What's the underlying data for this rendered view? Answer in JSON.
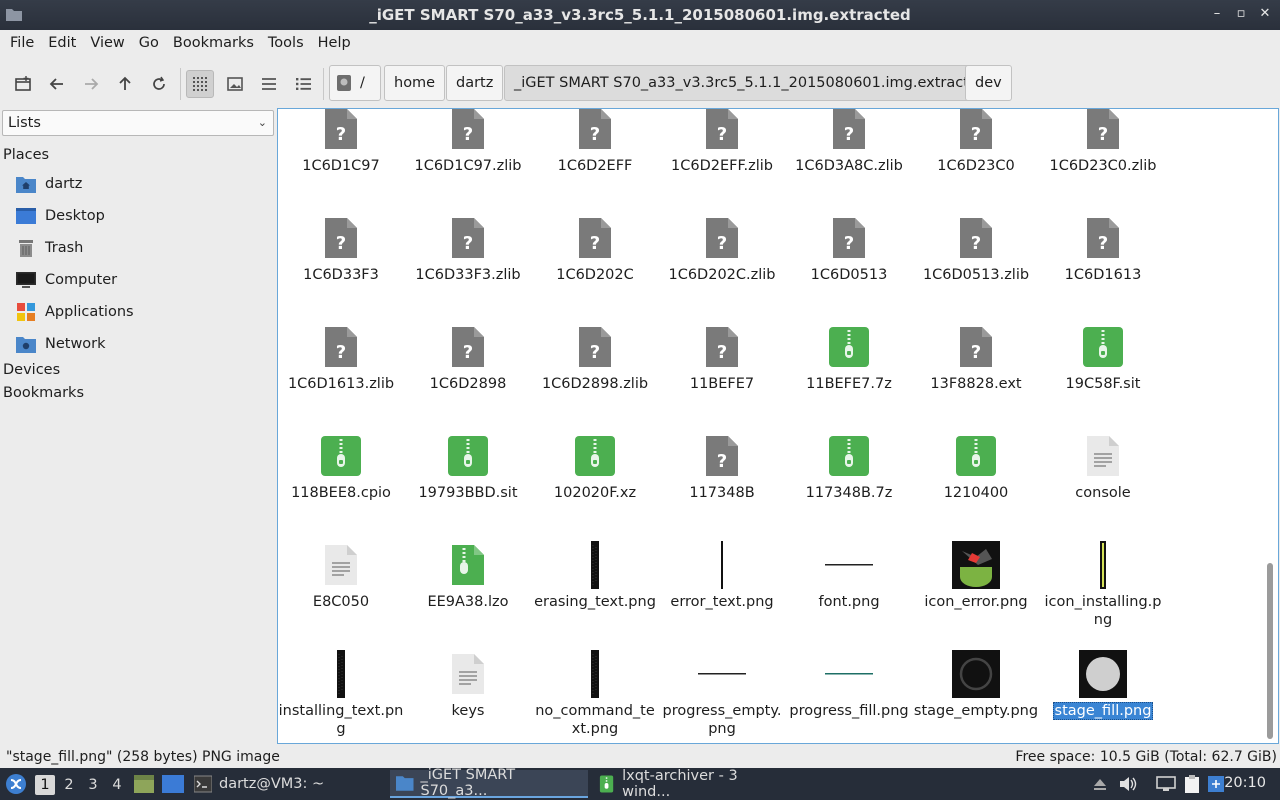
{
  "window": {
    "title": "_iGET SMART S70_a33_v3.3rc5_5.1.1_2015080601.img.extracted",
    "controls": [
      "–",
      "▫",
      "✕"
    ]
  },
  "menu": [
    "File",
    "Edit",
    "View",
    "Go",
    "Bookmarks",
    "Tools",
    "Help"
  ],
  "path": {
    "root": "/",
    "crumbs": [
      "home",
      "dartz",
      "_iGET SMART S70_a33_v3.3rc5_5.1.1_2015080601.img.extracted",
      "dev"
    ]
  },
  "sidebar": {
    "mode": "Lists",
    "places_header": "Places",
    "places": [
      {
        "label": "dartz",
        "icon": "home-folder-icon"
      },
      {
        "label": "Desktop",
        "icon": "desktop-icon"
      },
      {
        "label": "Trash",
        "icon": "trash-icon"
      },
      {
        "label": "Computer",
        "icon": "computer-icon"
      },
      {
        "label": "Applications",
        "icon": "applications-icon"
      },
      {
        "label": "Network",
        "icon": "network-icon"
      }
    ],
    "devices_header": "Devices",
    "bookmarks_header": "Bookmarks"
  },
  "files": [
    {
      "name": "1C6D1C97",
      "type": "unknown"
    },
    {
      "name": "1C6D1C97.zlib",
      "type": "unknown"
    },
    {
      "name": "1C6D2EFF",
      "type": "unknown"
    },
    {
      "name": "1C6D2EFF.zlib",
      "type": "unknown"
    },
    {
      "name": "1C6D3A8C.zlib",
      "type": "unknown"
    },
    {
      "name": "1C6D23C0",
      "type": "unknown"
    },
    {
      "name": "1C6D23C0.zlib",
      "type": "unknown"
    },
    {
      "name": "1C6D33F3",
      "type": "unknown"
    },
    {
      "name": "1C6D33F3.zlib",
      "type": "unknown"
    },
    {
      "name": "1C6D202C",
      "type": "unknown"
    },
    {
      "name": "1C6D202C.zlib",
      "type": "unknown"
    },
    {
      "name": "1C6D0513",
      "type": "unknown"
    },
    {
      "name": "1C6D0513.zlib",
      "type": "unknown"
    },
    {
      "name": "1C6D1613",
      "type": "unknown"
    },
    {
      "name": "1C6D1613.zlib",
      "type": "unknown"
    },
    {
      "name": "1C6D2898",
      "type": "unknown"
    },
    {
      "name": "1C6D2898.zlib",
      "type": "unknown"
    },
    {
      "name": "11BEFE7",
      "type": "unknown"
    },
    {
      "name": "11BEFE7.7z",
      "type": "archive"
    },
    {
      "name": "13F8828.ext",
      "type": "unknown"
    },
    {
      "name": "19C58F.sit",
      "type": "archive"
    },
    {
      "name": "118BEE8.cpio",
      "type": "archive"
    },
    {
      "name": "19793BBD.sit",
      "type": "archive"
    },
    {
      "name": "102020F.xz",
      "type": "archive"
    },
    {
      "name": "117348B",
      "type": "unknown"
    },
    {
      "name": "117348B.7z",
      "type": "archive"
    },
    {
      "name": "1210400",
      "type": "archive"
    },
    {
      "name": "console",
      "type": "text"
    },
    {
      "name": "E8C050",
      "type": "text"
    },
    {
      "name": "EE9A38.lzo",
      "type": "archive-page"
    },
    {
      "name": "erasing_text.png",
      "type": "img-vbar"
    },
    {
      "name": "error_text.png",
      "type": "img-vline"
    },
    {
      "name": "font.png",
      "type": "img-hline"
    },
    {
      "name": "icon_error.png",
      "type": "img-android"
    },
    {
      "name": "icon_installing.png",
      "type": "img-yellowbar"
    },
    {
      "name": "installing_text.png",
      "type": "img-vbar"
    },
    {
      "name": "keys",
      "type": "text"
    },
    {
      "name": "no_command_text.png",
      "type": "img-vbar"
    },
    {
      "name": "progress_empty.png",
      "type": "img-hline"
    },
    {
      "name": "progress_fill.png",
      "type": "img-hline-teal"
    },
    {
      "name": "stage_empty.png",
      "type": "img-ring"
    },
    {
      "name": "stage_fill.png",
      "type": "img-disc",
      "selected": true
    }
  ],
  "colors": {
    "archive_green": "#4caf50",
    "unknown_gray": "#7a7a7a",
    "selection_blue": "#3a85d4",
    "panel_bg": "#262d39"
  },
  "status": {
    "left": "\"stage_fill.png\" (258 bytes) PNG image",
    "right": "Free space: 10.5 GiB (Total: 62.7 GiB)"
  },
  "taskbar": {
    "desktops": [
      "1",
      "2",
      "3",
      "4"
    ],
    "tasks": [
      {
        "label": "dartz@VM3: ~",
        "icon": "terminal-icon"
      },
      {
        "label": "_iGET SMART S70_a3...",
        "icon": "folder-icon"
      },
      {
        "label": "lxqt-archiver - 3 wind...",
        "icon": "archive-icon"
      }
    ],
    "clock": "20:10"
  }
}
